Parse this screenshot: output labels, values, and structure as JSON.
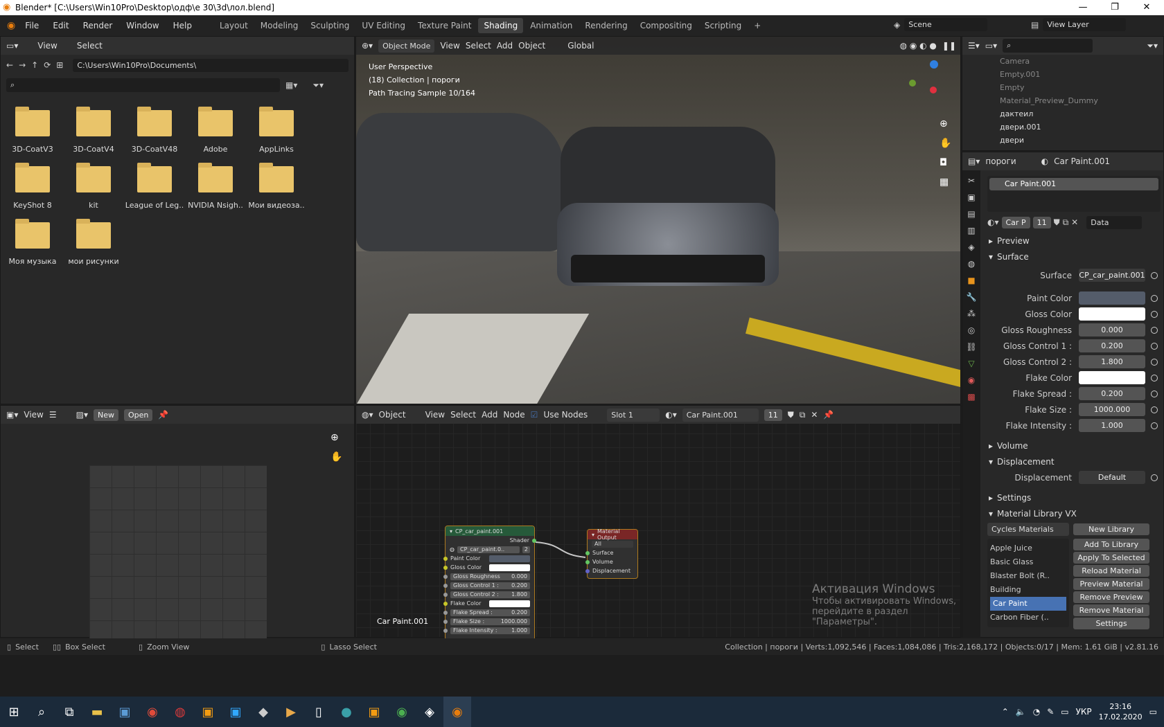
{
  "title": "Blender* [C:\\Users\\Win10Pro\\Desktop\\одф\\е 30\\3d\\лол.blend]",
  "menu": [
    "File",
    "Edit",
    "Render",
    "Window",
    "Help"
  ],
  "workspaces": [
    "Layout",
    "Modeling",
    "Sculpting",
    "UV Editing",
    "Texture Paint",
    "Shading",
    "Animation",
    "Rendering",
    "Compositing",
    "Scripting"
  ],
  "active_workspace": "Shading",
  "scene": "Scene",
  "view_layer": "View Layer",
  "file_browser": {
    "view": "View",
    "select": "Select",
    "path": "C:\\Users\\Win10Pro\\Documents\\",
    "folders": [
      "3D-CoatV3",
      "3D-CoatV4",
      "3D-CoatV48",
      "Adobe",
      "AppLinks",
      "KeyShot 8",
      "kit",
      "League of Leg..",
      "NVIDIA Nsigh..",
      "Мои видеоза..",
      "Моя музыка",
      "мои рисунки"
    ]
  },
  "viewport": {
    "mode": "Object Mode",
    "menus": [
      "View",
      "Select",
      "Add",
      "Object"
    ],
    "orientation": "Global",
    "overlay_lines": [
      "User Perspective",
      "(18) Collection | пороги",
      "Path Tracing Sample 10/164"
    ]
  },
  "image_editor": {
    "view": "View",
    "new": "New",
    "open": "Open"
  },
  "node_editor": {
    "mode": "Object",
    "menus": [
      "View",
      "Select",
      "Add",
      "Node"
    ],
    "use_nodes": "Use Nodes",
    "slot": "Slot 1",
    "material": "Car Paint.001",
    "users": "11",
    "material_label": "Car Paint.001",
    "group_node": {
      "title": "CP_car_paint.001",
      "output": "Shader",
      "datablock": "CP_car_paint.0..",
      "users": "2",
      "inputs": [
        {
          "label": "Paint Color",
          "value": ""
        },
        {
          "label": "Gloss Color",
          "value": ""
        },
        {
          "label": "Gloss Roughness",
          "value": "0.000"
        },
        {
          "label": "Gloss Control 1 :",
          "value": "0.200"
        },
        {
          "label": "Gloss Control 2 :",
          "value": "1.800"
        },
        {
          "label": "Flake Color",
          "value": ""
        },
        {
          "label": "Flake Spread :",
          "value": "0.200"
        },
        {
          "label": "Flake Size :",
          "value": "1000.000"
        },
        {
          "label": "Flake Intensity :",
          "value": "1.000"
        }
      ]
    },
    "output_node": {
      "title": "Material Output",
      "target": "All",
      "inputs": [
        "Surface",
        "Volume",
        "Displacement"
      ]
    }
  },
  "outliner": {
    "items": [
      "Camera",
      "Empty.001",
      "Empty",
      "Material_Preview_Dummy",
      "дактеил",
      "двери.001",
      "двери"
    ]
  },
  "properties": {
    "object": "пороги",
    "material": "Car Paint.001",
    "slot_item": "Car Paint.001",
    "datablock_short": "Car P",
    "users": "11",
    "link": "Data",
    "sections": {
      "preview": "Preview",
      "surface": "Surface",
      "volume": "Volume",
      "displacement": "Displacement",
      "settings": "Settings",
      "matlib": "Material Library VX"
    },
    "surface_label": "Surface",
    "surface_value": "CP_car_paint.001",
    "rows": [
      {
        "label": "Paint Color",
        "value": "",
        "color": "#545c6a"
      },
      {
        "label": "Gloss Color",
        "value": "",
        "color": "#ffffff"
      },
      {
        "label": "Gloss Roughness",
        "value": "0.000"
      },
      {
        "label": "Gloss Control 1 :",
        "value": "0.200"
      },
      {
        "label": "Gloss Control 2 :",
        "value": "1.800"
      },
      {
        "label": "Flake Color",
        "value": "",
        "color": "#ffffff"
      },
      {
        "label": "Flake Spread :",
        "value": "0.200"
      },
      {
        "label": "Flake Size :",
        "value": "1000.000"
      },
      {
        "label": "Flake Intensity :",
        "value": "1.000"
      }
    ],
    "displacement_label": "Displacement",
    "displacement_value": "Default",
    "library_select": "Cycles Materials",
    "library_list": [
      "Apple Juice",
      "Basic Glass",
      "Blaster Bolt (R..",
      "Building",
      "Car Paint",
      "Carbon Fiber (.."
    ],
    "library_selected": "Car Paint",
    "library_buttons": [
      "New Library",
      "Add To Library",
      "Apply To Selected",
      "Reload Material",
      "Preview Material",
      "Remove Preview",
      "Remove Material",
      "Settings"
    ]
  },
  "activation": {
    "title": "Активация Windows",
    "line1": "Чтобы активировать Windows, перейдите в раздел",
    "line2": "\"Параметры\"."
  },
  "status": {
    "select": "Select",
    "box_select": "Box Select",
    "zoom_view": "Zoom View",
    "lasso_select": "Lasso Select",
    "stats": "Collection | пороги | Verts:1,092,546 | Faces:1,084,086 | Tris:2,168,172 | Objects:0/17 | Mem: 1.61 GiB | v2.81.16"
  },
  "taskbar": {
    "lang": "УКР",
    "time": "23:16",
    "date": "17.02.2020"
  }
}
